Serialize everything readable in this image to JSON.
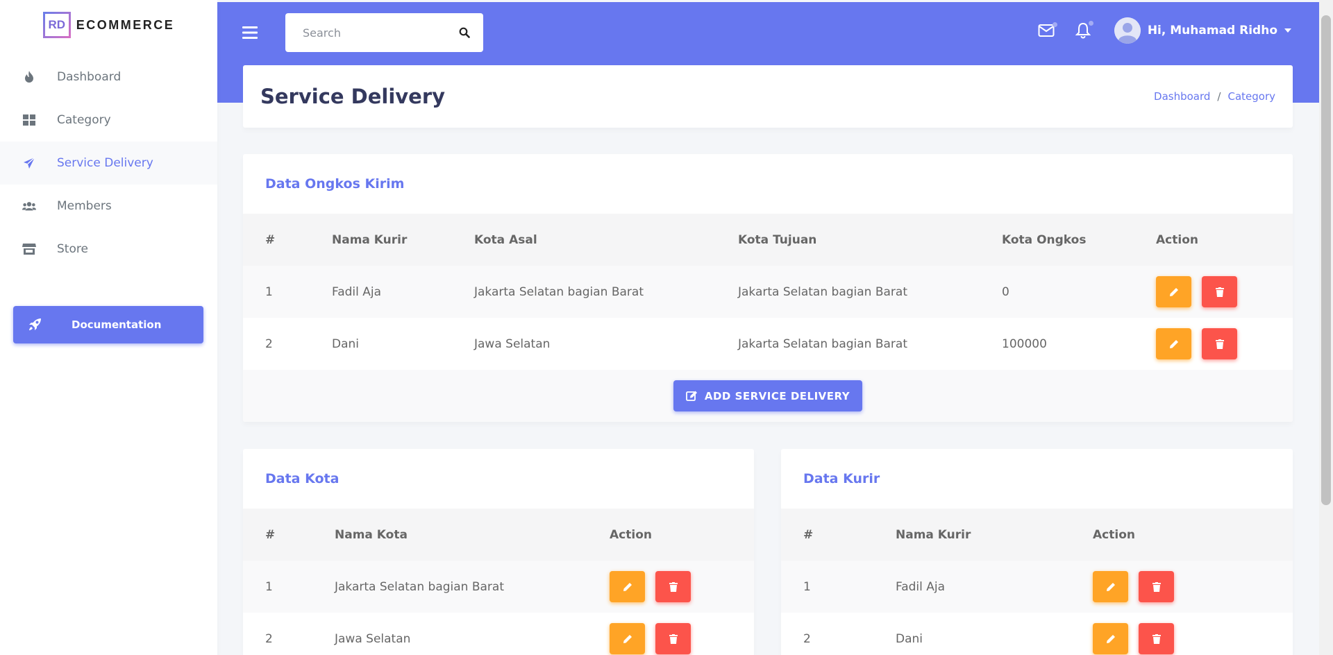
{
  "brand": {
    "logo": "RD",
    "name": "ECOMMERCE"
  },
  "sidebar": {
    "items": [
      {
        "label": "Dashboard",
        "icon": "fire-icon"
      },
      {
        "label": "Category",
        "icon": "grid-icon"
      },
      {
        "label": "Service Delivery",
        "icon": "paper-plane-icon",
        "active": true
      },
      {
        "label": "Members",
        "icon": "users-icon"
      },
      {
        "label": "Store",
        "icon": "store-icon"
      }
    ],
    "documentation_label": "Documentation"
  },
  "header": {
    "search_placeholder": "Search",
    "user_greeting": "Hi, Muhamad Ridho"
  },
  "page": {
    "title": "Service Delivery",
    "breadcrumb": [
      "Dashboard",
      "Category"
    ]
  },
  "ongkos": {
    "title": "Data Ongkos Kirim",
    "columns": [
      "#",
      "Nama Kurir",
      "Kota Asal",
      "Kota Tujuan",
      "Kota Ongkos",
      "Action"
    ],
    "rows": [
      {
        "no": "1",
        "kurir": "Fadil Aja",
        "asal": "Jakarta Selatan bagian Barat",
        "tujuan": "Jakarta Selatan bagian Barat",
        "ongkos": "0"
      },
      {
        "no": "2",
        "kurir": "Dani",
        "asal": "Jawa Selatan",
        "tujuan": "Jakarta Selatan bagian Barat",
        "ongkos": "100000"
      }
    ],
    "add_label": "ADD SERVICE DELIVERY"
  },
  "kota": {
    "title": "Data Kota",
    "columns": [
      "#",
      "Nama Kota",
      "Action"
    ],
    "rows": [
      {
        "no": "1",
        "nama": "Jakarta Selatan bagian Barat"
      },
      {
        "no": "2",
        "nama": "Jawa Selatan"
      }
    ]
  },
  "kurir": {
    "title": "Data Kurir",
    "columns": [
      "#",
      "Nama Kurir",
      "Action"
    ],
    "rows": [
      {
        "no": "1",
        "nama": "Fadil Aja"
      },
      {
        "no": "2",
        "nama": "Dani"
      }
    ]
  },
  "colors": {
    "primary": "#6777ef",
    "warning": "#ffa426",
    "danger": "#fc544b"
  }
}
